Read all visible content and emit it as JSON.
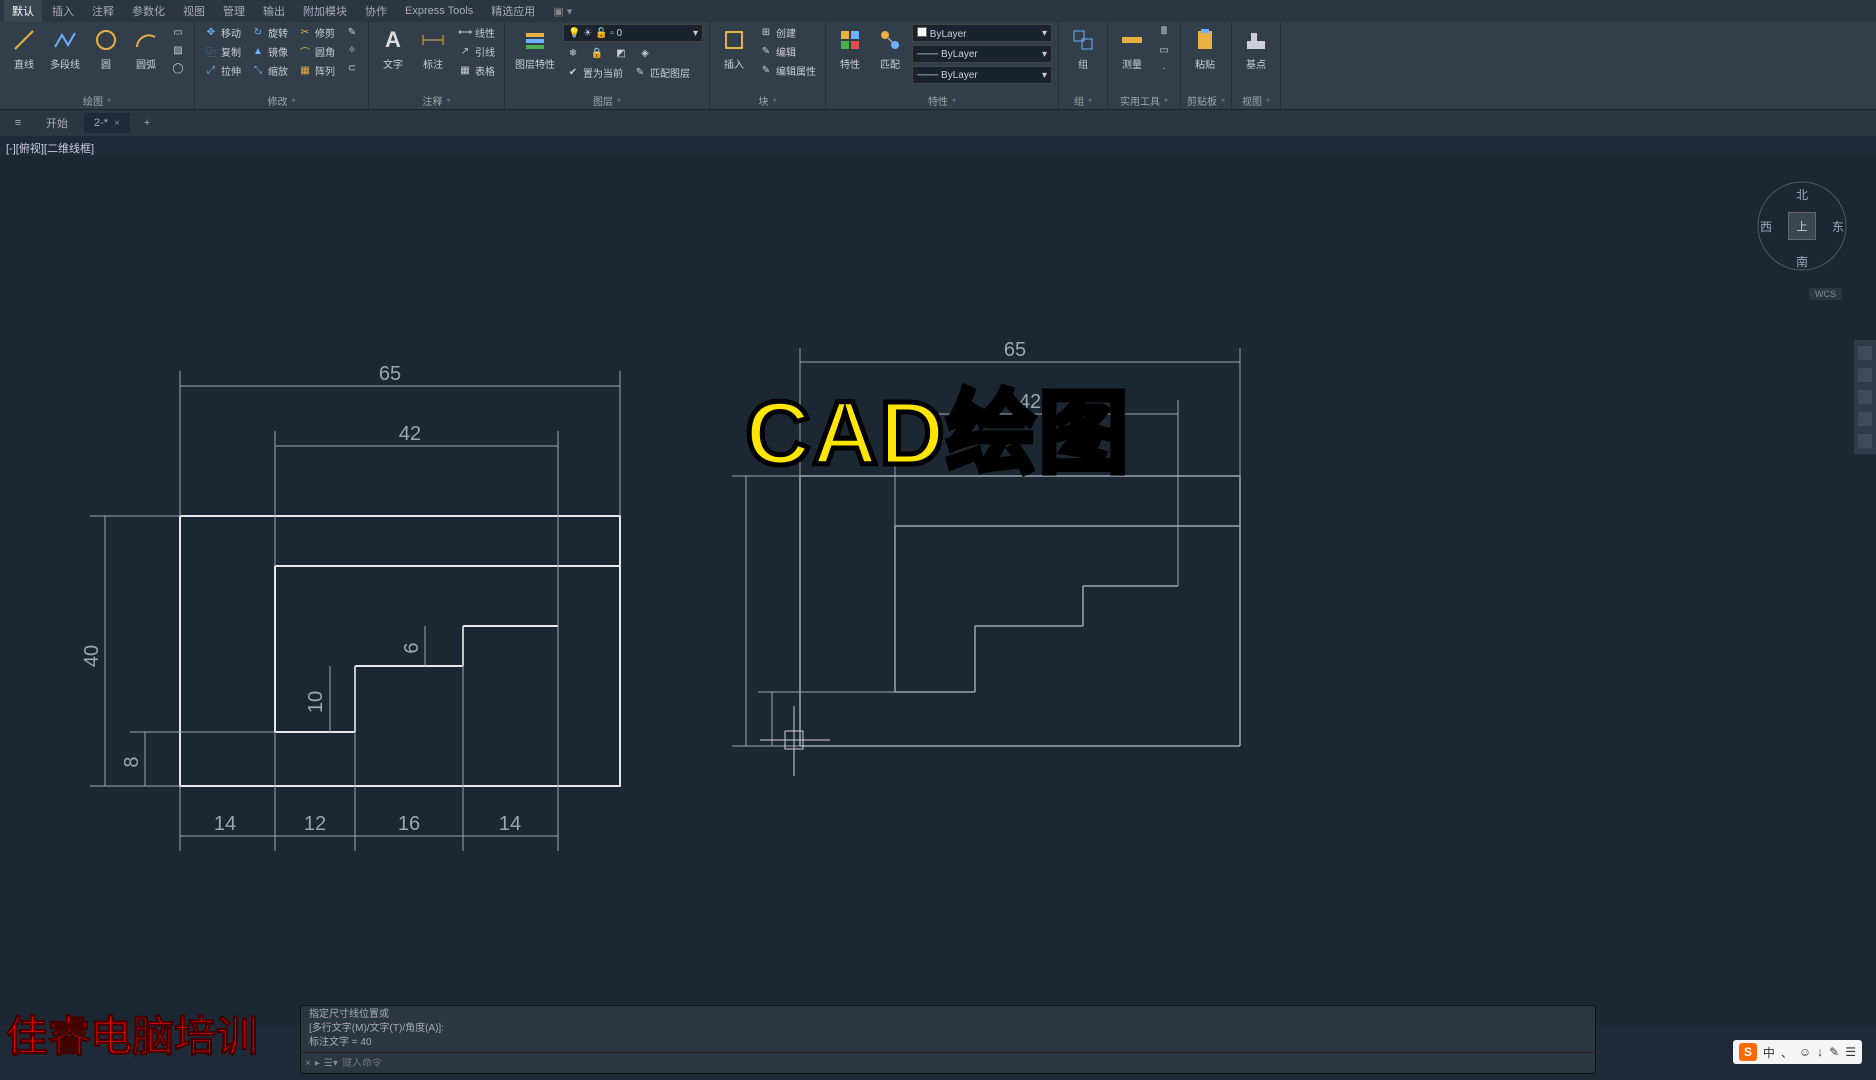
{
  "menu_tabs": [
    "默认",
    "插入",
    "注释",
    "参数化",
    "视图",
    "管理",
    "输出",
    "附加模块",
    "协作",
    "Express Tools",
    "精选应用"
  ],
  "menu_active_index": 0,
  "ribbon": {
    "draw": {
      "title": "绘图",
      "line": "直线",
      "polyline": "多段线",
      "circle": "圆",
      "arc": "圆弧"
    },
    "modify": {
      "title": "修改",
      "move": "移动",
      "rotate": "旋转",
      "trim": "修剪",
      "copy": "复制",
      "mirror": "镜像",
      "fillet": "圆角",
      "stretch": "拉伸",
      "scale": "缩放",
      "array": "阵列"
    },
    "annot": {
      "title": "注释",
      "text": "文字",
      "dim": "标注",
      "leader": "引线",
      "linetype": "线性",
      "table": "表格"
    },
    "layers": {
      "title": "图层",
      "props": "图层特性",
      "setcurrent": "置为当前",
      "match": "匹配图层"
    },
    "blocks": {
      "title": "块",
      "insert": "插入",
      "create": "创建",
      "edit": "编辑",
      "attr": "编辑属性"
    },
    "props": {
      "title": "特性",
      "button": "特性",
      "match": "匹配",
      "sel1": "ByLayer",
      "sel2": "ByLayer",
      "sel3": "ByLayer"
    },
    "groups": {
      "title": "组",
      "btn": "组"
    },
    "utils": {
      "title": "实用工具",
      "measure": "测量"
    },
    "clip": {
      "title": "剪贴板",
      "paste": "粘贴"
    },
    "view": {
      "title": "视图",
      "base": "基点"
    }
  },
  "file_tabs": {
    "start": "开始",
    "active": "2-*",
    "plus": "+"
  },
  "viewport_label": "[-][俯视][二维线框]",
  "compass": {
    "n": "北",
    "s": "南",
    "e": "东",
    "w": "西",
    "face": "上"
  },
  "wcs": "WCS",
  "overlay_title": "CAD绘图",
  "watermark": "佳睿电脑培训",
  "dimensions": {
    "top65": "65",
    "top42": "42",
    "left40": "40",
    "left8": "8",
    "h14a": "14",
    "h12": "12",
    "h16": "16",
    "h14b": "14",
    "v10": "10",
    "v6": "6",
    "r_top65": "65",
    "r_top42": "42"
  },
  "command": {
    "hist1": "指定尺寸线位置或",
    "hist2": "[多行文字(M)/文字(T)/角度(A)]:",
    "hist3": "标注文字 = 40",
    "placeholder": "键入命令"
  },
  "ime": {
    "logo": "S",
    "items": [
      "中",
      "、",
      "☺",
      "↓",
      "✎",
      "☰"
    ]
  },
  "win_controls": [
    "—",
    "◻",
    "×"
  ]
}
